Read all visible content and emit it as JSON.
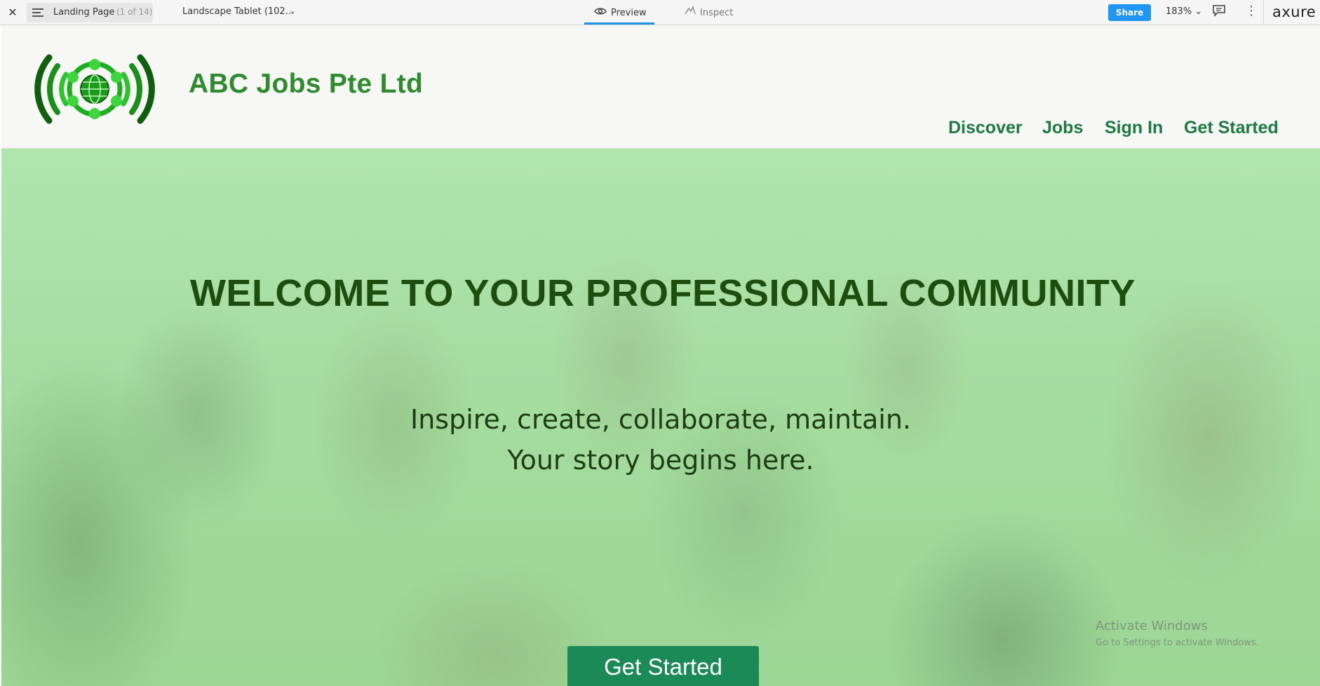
{
  "toolbar": {
    "page_name": "Landing Page",
    "page_count": "(1 of 14)",
    "viewport": "Landscape Tablet (102...",
    "tabs": {
      "preview": "Preview",
      "inspect": "Inspect"
    },
    "share_label": "Share",
    "zoom": "183%",
    "brand": "axure",
    "icons": [
      "close-icon",
      "menu-icon",
      "chevron-down-icon",
      "eye-icon",
      "inspect-icon",
      "comment-icon",
      "more-vertical-icon"
    ],
    "accent": "#2196f3"
  },
  "header": {
    "site_title": "ABC Jobs Pte Ltd",
    "nav": {
      "discover": "Discover",
      "jobs": "Jobs",
      "sign_in": "Sign In",
      "get_started": "Get Started"
    },
    "colors": {
      "title": "#2e8b2e",
      "nav": "#1e7a43"
    }
  },
  "hero": {
    "title": "WELCOME TO YOUR PROFESSIONAL COMMUNITY",
    "subtitle_line1": "Inspire, create, collaborate, maintain.",
    "subtitle_line2": "Your story begins here.",
    "cta_label": "Get Started",
    "colors": {
      "title": "#1e4e0f",
      "cta": "#1b8a56"
    }
  },
  "watermark": {
    "line1": "Activate Windows",
    "line2": "Go to Settings to activate Windows."
  }
}
